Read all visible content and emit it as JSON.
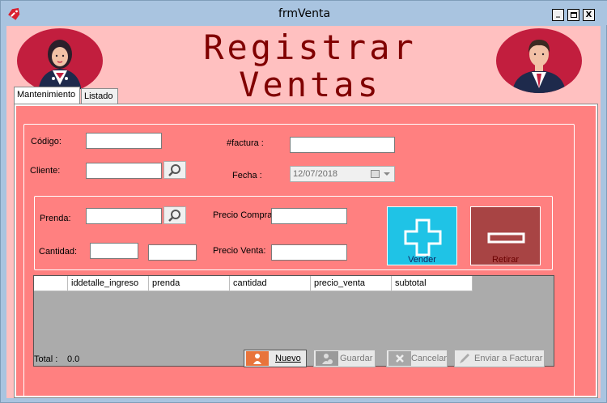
{
  "window": {
    "title": "frmVenta",
    "minimize": "_",
    "maximize": "□",
    "close": "X"
  },
  "header": {
    "title_line1": "Registrar",
    "title_line2": "Ventas"
  },
  "tabs": [
    {
      "label": "Mantenimiento"
    },
    {
      "label": "Listado"
    }
  ],
  "form": {
    "codigo_label": "Código:",
    "codigo_value": "",
    "factura_label": "#factura :",
    "factura_value": "",
    "cliente_label": "Cliente:",
    "cliente_value": "",
    "fecha_label": "Fecha :",
    "fecha_value": "12/07/2018"
  },
  "detail": {
    "prenda_label": "Prenda:",
    "prenda_value": "",
    "cantidad_label": "Cantidad:",
    "cantidad_value": "",
    "cantidad_extra_value": "",
    "precio_compra_label": "Precio Compra:",
    "precio_compra_value": "",
    "precio_venta_label": "Precio Venta:",
    "precio_venta_value": "",
    "vender_label": "Vender",
    "retirar_label": "Retirar",
    "vender_color": "#1fc3e6",
    "retirar_color": "#a84444"
  },
  "grid": {
    "columns": [
      "",
      "iddetalle_ingreso",
      "prenda",
      "cantidad",
      "precio_venta",
      "subtotal"
    ],
    "rows": []
  },
  "footer": {
    "total_label": "Total :",
    "total_value": "0.0",
    "nuevo_label": "Nuevo",
    "guardar_label": "Guardar",
    "cancelar_label": "Cancelar",
    "enviar_label": "Enviar a Facturar"
  }
}
